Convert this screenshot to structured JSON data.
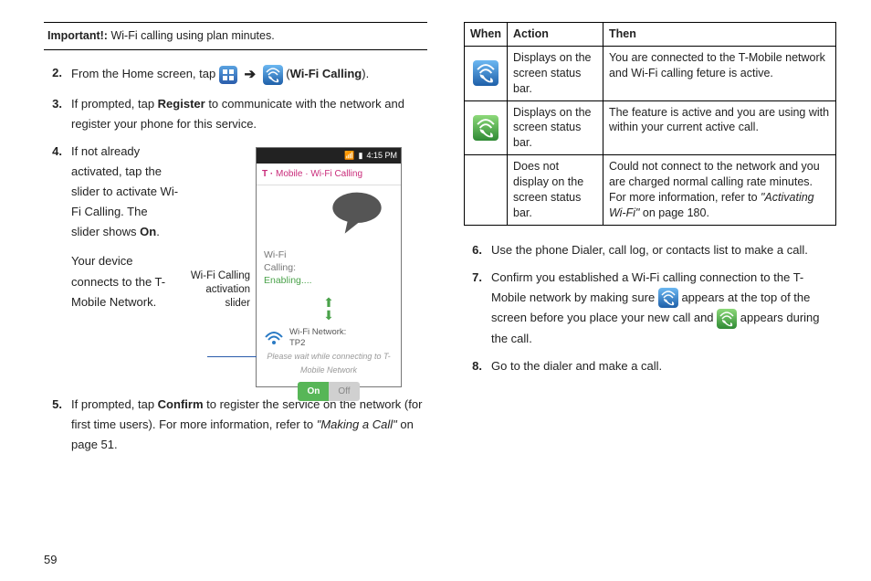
{
  "important": {
    "label": "Important!:",
    "text": "Wi-Fi calling using plan minutes."
  },
  "steps_left": {
    "s2": {
      "num": "2.",
      "pre": "From the Home screen, tap ",
      "post_a": " (",
      "wifi_calling": "Wi-Fi Calling",
      "post_b": ")."
    },
    "s3": {
      "num": "3.",
      "pre": "If prompted, tap ",
      "register": "Register",
      "post": " to communicate with the network and register your phone for this service."
    },
    "s4": {
      "num": "4.",
      "p1a": "If not already activated, tap the slider to activate Wi-Fi Calling. The slider shows ",
      "on": "On",
      "p1b": ".",
      "p2": "Your device connects to the T-Mobile Network."
    },
    "s5": {
      "num": "5.",
      "pre": "If prompted, tap ",
      "confirm": "Confirm",
      "mid": " to register the service on the network (for first time users). For more information, refer to ",
      "ref": "\"Making a Call\"",
      "post": " on page 51."
    }
  },
  "annot": "Wi-Fi Calling activation slider",
  "phone": {
    "time": "4:15 PM",
    "title": "Mobile · Wi-Fi Calling",
    "wifi_l1": "Wi-Fi",
    "wifi_l2": "Calling:",
    "wifi_l3": "Enabling....",
    "net_l1": "Wi-Fi Network:",
    "net_l2": "TP2",
    "connecting": "Please wait while connecting to T-Mobile Network",
    "on": "On",
    "off": "Off"
  },
  "table": {
    "h1": "When",
    "h2": "Action",
    "h3": "Then",
    "r1": {
      "action": "Displays on the screen status bar.",
      "then": "You are connected to the T-Mobile network and Wi-Fi calling feture is active."
    },
    "r2": {
      "action": "Displays on the screen status bar.",
      "then": "The feature is active and you are using with within your current active call."
    },
    "r3": {
      "action": "Does not display on the screen status bar.",
      "then_a": "Could not connect to the network and you are charged normal calling rate minutes. For more information, refer to ",
      "then_ref": "\"Activating Wi-Fi\"",
      "then_b": " on page 180."
    }
  },
  "steps_right": {
    "s6": {
      "num": "6.",
      "text": "Use the phone Dialer, call log, or contacts list to make a call."
    },
    "s7": {
      "num": "7.",
      "a": "Confirm you established a Wi-Fi calling connection to the T-Mobile network by making sure ",
      "b": " appears at the top of the screen before you place your new call and ",
      "c": " appears during the call."
    },
    "s8": {
      "num": "8.",
      "text": "Go to the dialer and make a call."
    }
  },
  "page": "59",
  "arrow": "➔"
}
